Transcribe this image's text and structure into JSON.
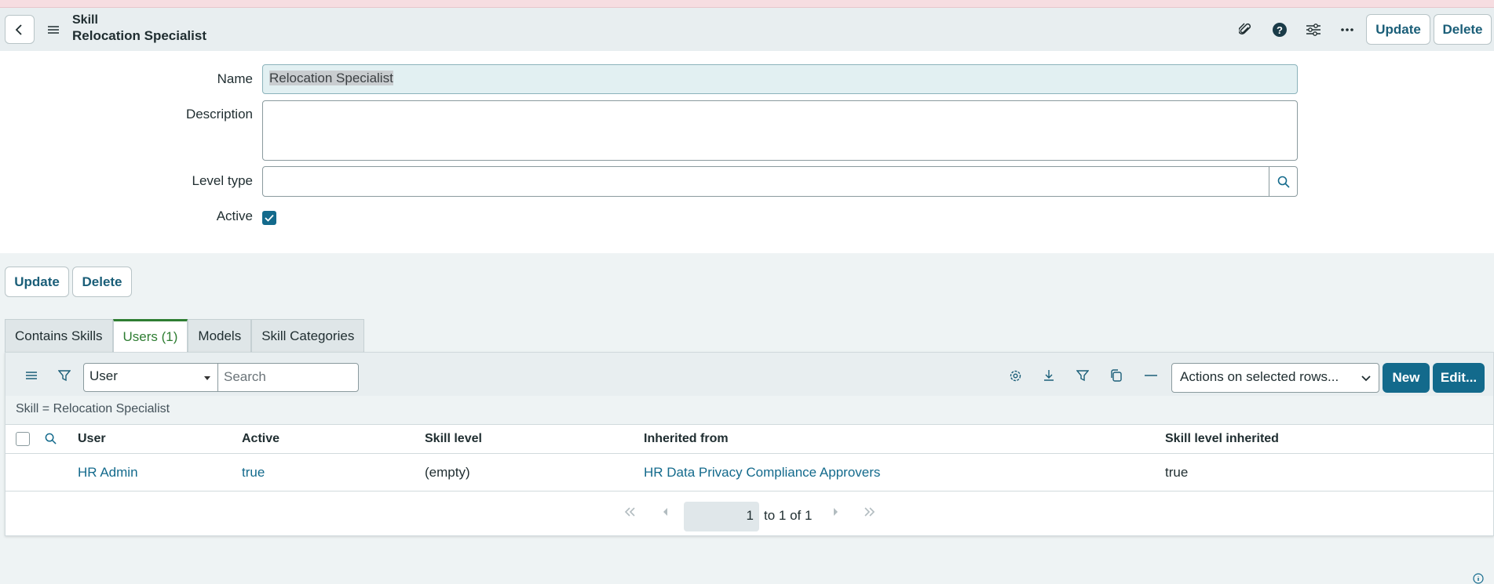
{
  "header": {
    "record_type": "Skill",
    "record_name": "Relocation Specialist",
    "update_label": "Update",
    "delete_label": "Delete",
    "icons": [
      "back-icon",
      "menu-icon",
      "paperclip-icon",
      "help-icon",
      "settings-sliders-icon",
      "more-icon"
    ]
  },
  "form": {
    "name_label": "Name",
    "name_value": "Relocation Specialist",
    "description_label": "Description",
    "description_value": "",
    "level_type_label": "Level type",
    "level_type_value": "",
    "active_label": "Active",
    "active_checked": true
  },
  "actions": {
    "update_label": "Update",
    "delete_label": "Delete"
  },
  "tabs": [
    {
      "label": "Contains Skills",
      "active": false
    },
    {
      "label": "Users (1)",
      "active": true
    },
    {
      "label": "Models",
      "active": false
    },
    {
      "label": "Skill Categories",
      "active": false
    }
  ],
  "list": {
    "field_select": "User",
    "search_placeholder": "Search",
    "actions_select": "Actions on selected rows...",
    "new_label": "New",
    "edit_label": "Edit...",
    "breadcrumb": "Skill = Relocation Specialist",
    "columns": [
      "User",
      "Active",
      "Skill level",
      "Inherited from",
      "Skill level inherited"
    ],
    "rows": [
      {
        "user": "HR Admin",
        "active": "true",
        "skill_level": "(empty)",
        "inherited_from": "HR Data Privacy Compliance Approvers",
        "skill_level_inherited": "true"
      }
    ],
    "pager": {
      "current": "1",
      "range_text": "to 1 of 1"
    }
  },
  "colors": {
    "accent": "#136a8c",
    "active_tab": "#2e7d32"
  }
}
